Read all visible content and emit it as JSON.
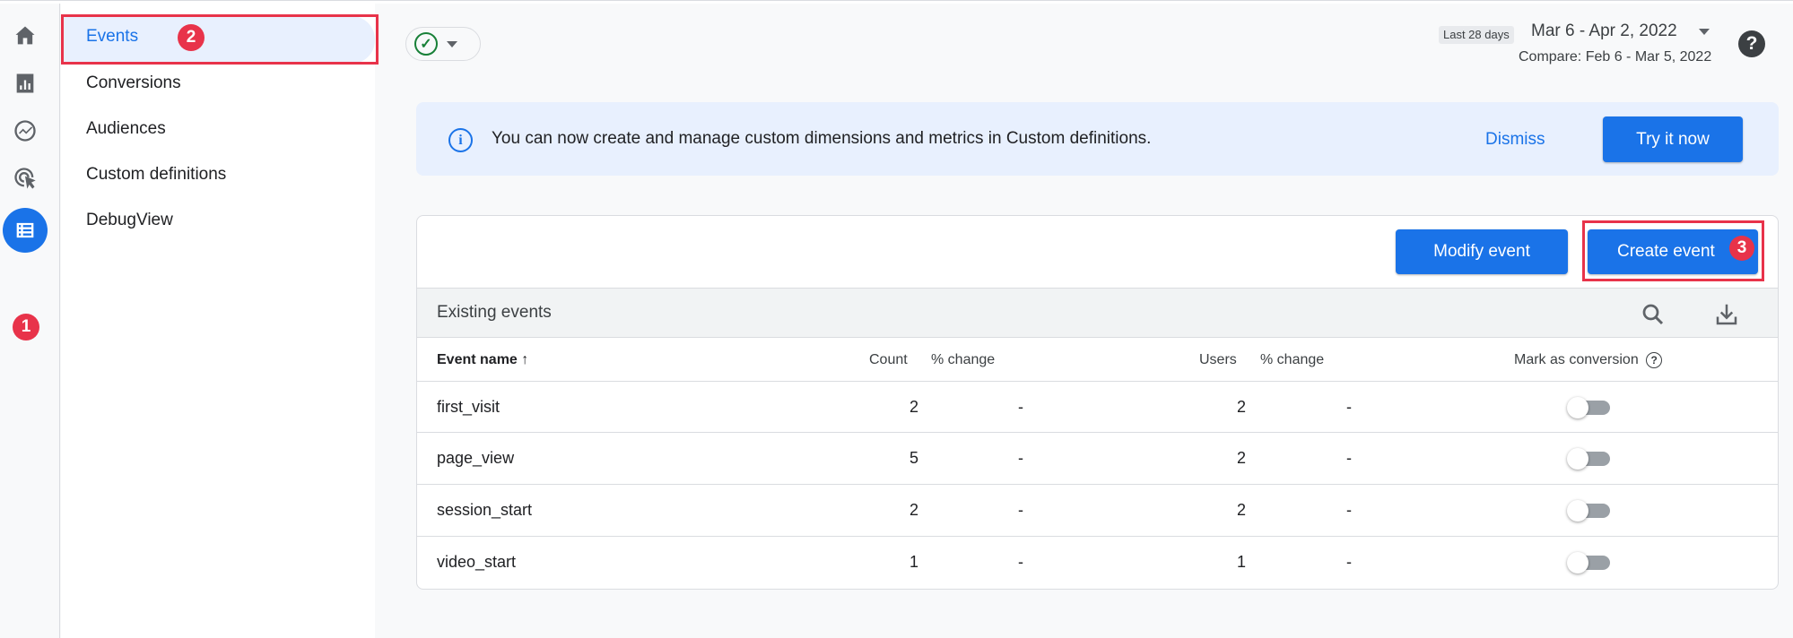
{
  "sidebar": {
    "items": [
      {
        "label": "Events"
      },
      {
        "label": "Conversions"
      },
      {
        "label": "Audiences"
      },
      {
        "label": "Custom definitions"
      },
      {
        "label": "DebugView"
      }
    ]
  },
  "annotations": [
    "1",
    "2",
    "3"
  ],
  "header": {
    "date_hint": "Last 28 days",
    "date_range": "Mar 6 - Apr 2, 2022",
    "compare": "Compare: Feb 6 - Mar 5, 2022",
    "help": "?"
  },
  "banner": {
    "text": "You can now create and manage custom dimensions and metrics in Custom definitions.",
    "dismiss": "Dismiss",
    "try_it": "Try it now",
    "info_glyph": "i"
  },
  "card": {
    "modify_event": "Modify event",
    "create_event": "Create event",
    "title": "Existing events",
    "columns": {
      "event_name": "Event name",
      "sort_arrow": "↑",
      "count": "Count",
      "count_change": "% change",
      "users": "Users",
      "users_change": "% change",
      "mark_conversion": "Mark as conversion",
      "help_glyph": "?"
    },
    "rows": [
      {
        "name": "first_visit",
        "count": "2",
        "count_change": "-",
        "users": "2",
        "users_change": "-",
        "conversion": false
      },
      {
        "name": "page_view",
        "count": "5",
        "count_change": "-",
        "users": "2",
        "users_change": "-",
        "conversion": false
      },
      {
        "name": "session_start",
        "count": "2",
        "count_change": "-",
        "users": "2",
        "users_change": "-",
        "conversion": false
      },
      {
        "name": "video_start",
        "count": "1",
        "count_change": "-",
        "users": "1",
        "users_change": "-",
        "conversion": false
      }
    ]
  },
  "colors": {
    "accent": "#1a73e8",
    "annotation_red": "#e8334a",
    "status_green": "#188038"
  },
  "icons": [
    "home-icon",
    "reports-icon",
    "explore-icon",
    "advertising-icon",
    "configure-icon",
    "check-circle-icon",
    "info-icon",
    "search-icon",
    "download-icon",
    "help-icon"
  ]
}
